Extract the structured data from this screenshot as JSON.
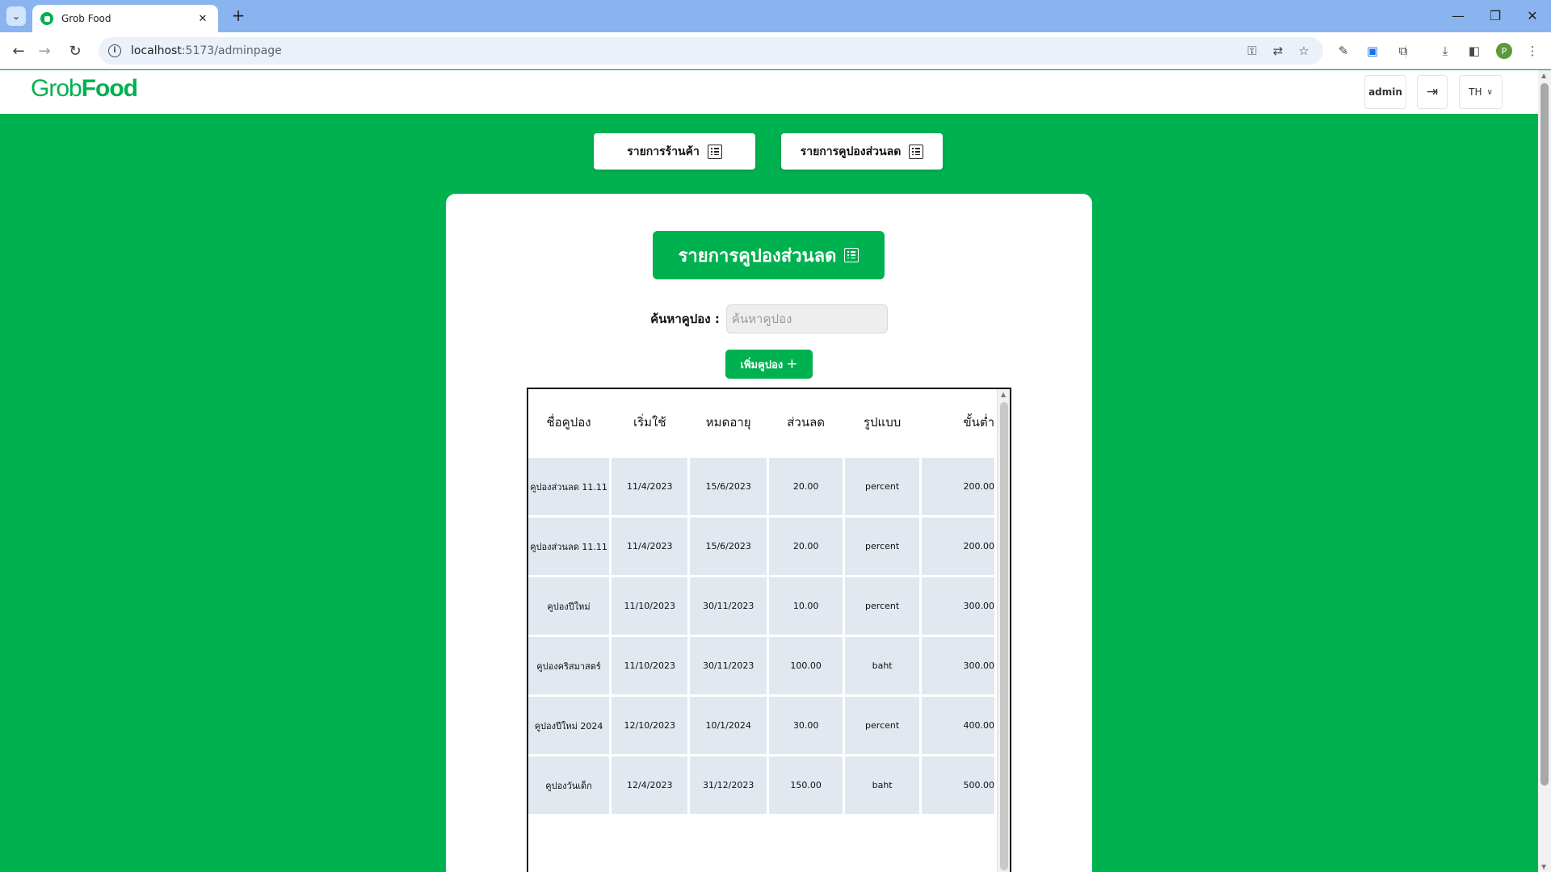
{
  "browser": {
    "tab_title": "Grob Food",
    "url_host": "localhost",
    "url_path": ":5173/adminpage",
    "profile_initial": "P"
  },
  "header": {
    "logo_part1": "Grob",
    "logo_part2": "Food",
    "user": "admin",
    "lang": "TH"
  },
  "nav": {
    "stores_label": "รายการร้านค้า",
    "coupons_label": "รายการคูปองส่วนลด"
  },
  "card": {
    "title": "รายการคูปองส่วนลด",
    "search_label": "ค้นหาคูปอง :",
    "search_placeholder": "ค้นหาคูปอง",
    "add_label": "เพิ่มคูปอง",
    "add_plus": "+"
  },
  "table": {
    "headers": [
      "ชื่อคูปอง",
      "เริ่มใช้",
      "หมดอายุ",
      "ส่วนลด",
      "รูปแบบ",
      "ขั้นต่ำ"
    ],
    "rows": [
      [
        "คูปองส่วนลด 11.11",
        "11/4/2023",
        "15/6/2023",
        "20.00",
        "percent",
        "200.00"
      ],
      [
        "คูปองส่วนลด 11.11",
        "11/4/2023",
        "15/6/2023",
        "20.00",
        "percent",
        "200.00"
      ],
      [
        "คูปองปีใหม่",
        "11/10/2023",
        "30/11/2023",
        "10.00",
        "percent",
        "300.00"
      ],
      [
        "คูปองคริสมาสตร์",
        "11/10/2023",
        "30/11/2023",
        "100.00",
        "baht",
        "300.00"
      ],
      [
        "คูปองปีใหม่ 2024",
        "12/10/2023",
        "10/1/2024",
        "30.00",
        "percent",
        "400.00"
      ],
      [
        "คูปองวันเด็ก",
        "12/4/2023",
        "31/12/2023",
        "150.00",
        "baht",
        "500.00"
      ]
    ]
  },
  "colors": {
    "brand_green": "#00b14f",
    "cell_bg": "#e2e8f0",
    "chrome_blue": "#8ab4f0"
  }
}
